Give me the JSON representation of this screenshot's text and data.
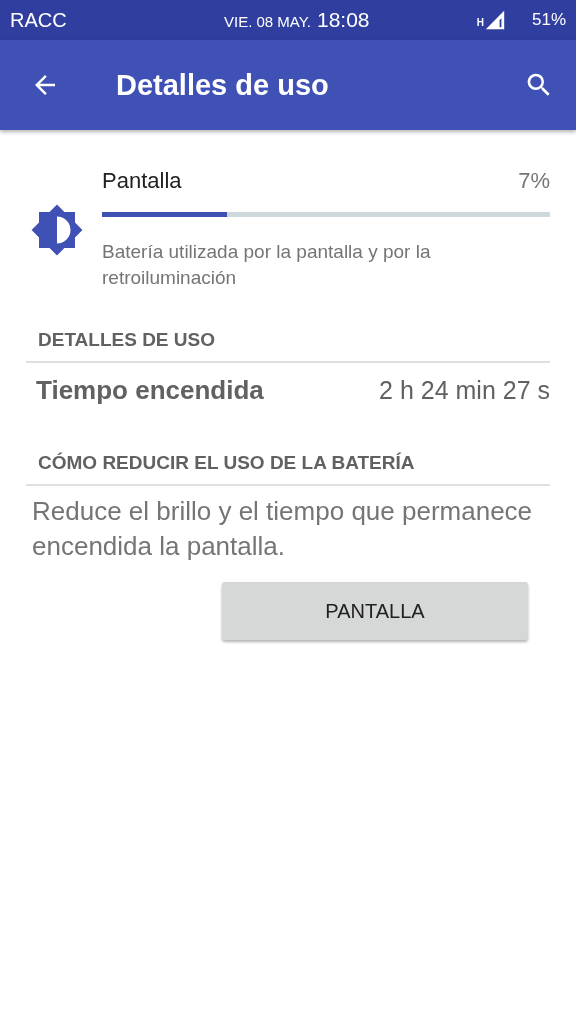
{
  "status_bar": {
    "carrier": "RACC",
    "date": "VIE. 08 MAY.",
    "time": "18:08",
    "network": "H",
    "battery": "51%"
  },
  "app_bar": {
    "title": "Detalles de uso"
  },
  "usage": {
    "name": "Pantalla",
    "percent": "7%",
    "level": 0.28,
    "description": "Batería utilizada por la pantalla y por la retroiluminación"
  },
  "details": {
    "header": "DETALLES DE USO",
    "rows": [
      {
        "label": "Tiempo encendida",
        "value": "2 h 24 min 27 s"
      }
    ]
  },
  "tips": {
    "header": "CÓMO REDUCIR EL USO DE LA BATERÍA",
    "text": "Reduce el brillo y el tiempo que permanece encendida la pantalla.",
    "button": "PANTALLA"
  }
}
